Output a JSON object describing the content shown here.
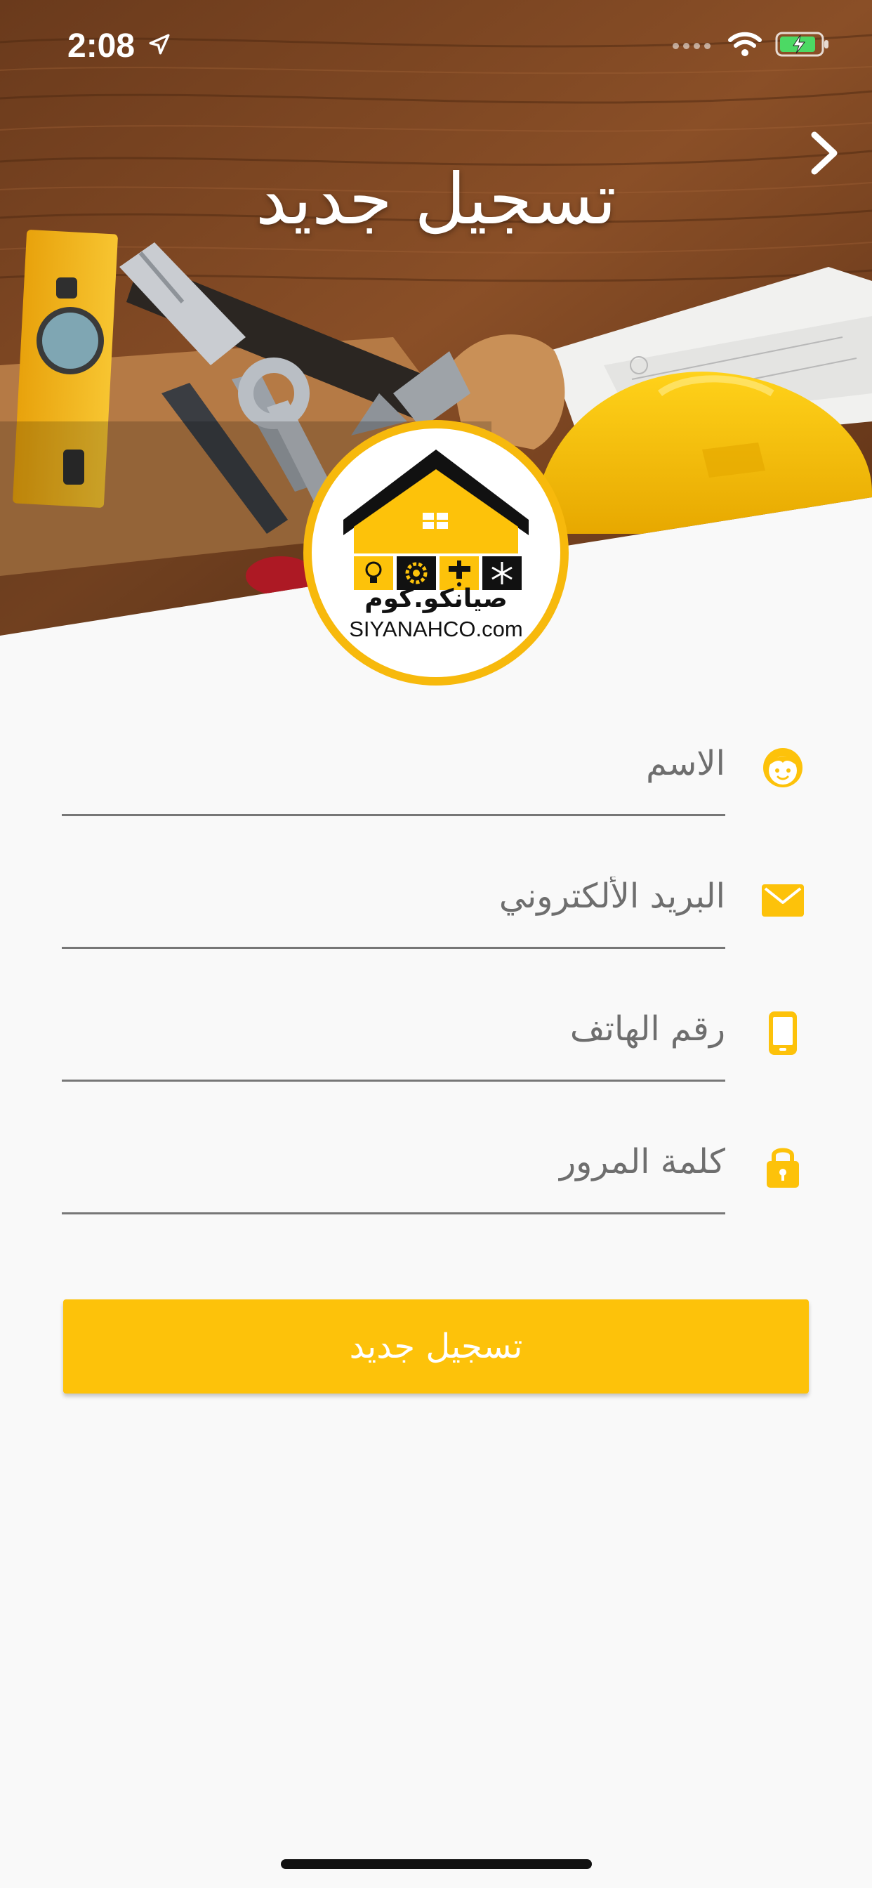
{
  "status_bar": {
    "time": "2:08",
    "icons": [
      "location-arrow-icon",
      "wifi-icon",
      "battery-charging-icon"
    ]
  },
  "header": {
    "title": "تسجيل جديد",
    "back_icon": "chevron-right-icon"
  },
  "logo": {
    "arabic_text": "صيانكو.كوم",
    "english_text": "SIYANAHCO.com",
    "icons": [
      "lightbulb-icon",
      "gear-icon",
      "faucet-icon",
      "snowflake-icon"
    ]
  },
  "form": {
    "fields": [
      {
        "placeholder": "الاسم",
        "value": "",
        "icon": "face-icon"
      },
      {
        "placeholder": "البريد الألكتروني",
        "value": "",
        "icon": "envelope-icon"
      },
      {
        "placeholder": "رقم الهاتف",
        "value": "",
        "icon": "mobile-phone-icon"
      },
      {
        "placeholder": "كلمة المرور",
        "value": "",
        "icon": "lock-icon"
      }
    ],
    "submit_label": "تسجيل جديد"
  },
  "colors": {
    "accent": "#fdc20a",
    "logo_ring": "#f7b90c",
    "background": "#f9f9f9",
    "battery": "#4cd964"
  }
}
